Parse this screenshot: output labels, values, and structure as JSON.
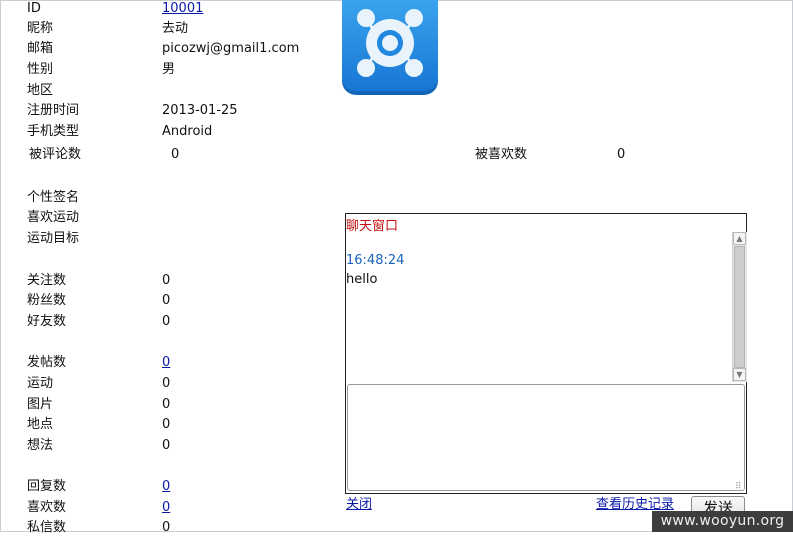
{
  "profile": {
    "id_label": "ID",
    "id_value": "10001",
    "nickname_label": "昵称",
    "nickname_value": "去动",
    "email_label": "邮箱",
    "email_value": "picozwj@gmail1.com",
    "gender_label": "性别",
    "gender_value": "男",
    "region_label": "地区",
    "region_value": "",
    "register_label": "注册时间",
    "register_value": "2013-01-25",
    "phone_label": "手机类型",
    "phone_value": "Android",
    "commented_label": "被评论数",
    "commented_value": "0",
    "liked_label": "被喜欢数",
    "liked_value": "0",
    "signature_label": "个性签名",
    "signature_value": "",
    "fav_sport_label": "喜欢运动",
    "fav_sport_value": "",
    "sport_goal_label": "运动目标",
    "sport_goal_value": ""
  },
  "stats": {
    "following_label": "关注数",
    "following_value": "0",
    "fans_label": "粉丝数",
    "fans_value": "0",
    "friends_label": "好友数",
    "friends_value": "0",
    "posts_label": "发帖数",
    "posts_value": "0",
    "sport_label": "运动",
    "sport_value": "0",
    "photo_label": "图片",
    "photo_value": "0",
    "place_label": "地点",
    "place_value": "0",
    "idea_label": "想法",
    "idea_value": "0",
    "replies_label": "回复数",
    "replies_value": "0",
    "likes_label": "喜欢数",
    "likes_value": "0",
    "pm_label": "私信数",
    "pm_value": "0"
  },
  "chat": {
    "title": "聊天窗口",
    "message_time": "16:48:24",
    "message_text": "hello",
    "input_value": "",
    "close_label": "关闭",
    "history_label": "查看历史记录",
    "send_label": "发送"
  },
  "watermark": "www.wooyun.org",
  "colors": {
    "link": "#0a1aa8",
    "chat_title": "#c41010",
    "timestamp": "#1a63b8",
    "logo_blue": "#1e86e0"
  },
  "icons": {
    "app_logo": "app-logo-icon"
  }
}
